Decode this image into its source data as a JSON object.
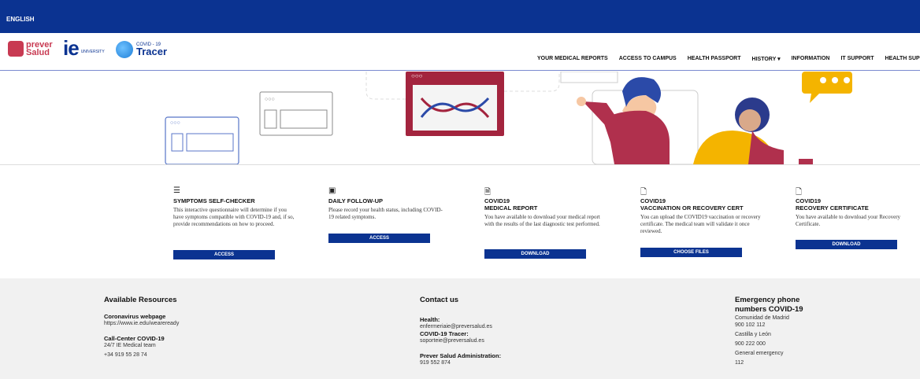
{
  "topbar": {
    "language": "ENGLISH"
  },
  "logos": {
    "prever": "prever Salud",
    "ie": "ie",
    "ie_sub": "UNIVERSITY",
    "tracer_small": "COVID - 19",
    "tracer_big": "Tracer"
  },
  "nav": {
    "items": [
      "YOUR MEDICAL REPORTS",
      "ACCESS TO CAMPUS",
      "HEALTH PASSPORT",
      "HISTORY ▾",
      "INFORMATION",
      "IT SUPPORT",
      "HEALTH SUPPO"
    ]
  },
  "cards": [
    {
      "icon": "list-icon",
      "title": "SYMPTOMS SELF-CHECKER",
      "desc": "This interactive questionnaire will determine if you have symptoms compatible with COVID-19 and, if so, provide recommendations on how to proceed.",
      "button": "ACCESS"
    },
    {
      "icon": "id-card-icon",
      "title": "DAILY FOLLOW-UP",
      "desc": "Please record your health status, including COVID-19 related symptoms.",
      "button": "ACCESS"
    },
    {
      "icon": "document-icon",
      "title": "COVID19\nMEDICAL REPORT",
      "title1": "COVID19",
      "title2": "MEDICAL REPORT",
      "desc": "You have available to download your medical report with the results of the last diagnostic test performed.",
      "button": "DOWNLOAD"
    },
    {
      "icon": "pdf-icon",
      "title1": "COVID19",
      "title2": "VACCINATION OR RECOVERY CERT",
      "desc": "You can upload the COVID19 vaccination or recovery certificate. The medical team will validate it once reviewed.",
      "button": "CHOOSE FILES"
    },
    {
      "icon": "pdf-icon",
      "title1": "COVID19",
      "title2": "RECOVERY CERTIFICATE",
      "desc": "You have available to download your Recovery Certificate.",
      "button": "DOWNLOAD"
    }
  ],
  "footer": {
    "resources": {
      "heading": "Available Resources",
      "webpage_label": "Coronavirus webpage",
      "webpage_url": "https://www.ie.edu/weareready",
      "callcenter_label": "Call-Center COVID-19",
      "callcenter_team": "24/7 IE Medical team",
      "callcenter_phone": "+34 919 55 28 74"
    },
    "contact": {
      "heading": "Contact us",
      "health_label": "Health:",
      "health_email": "enfermeriaie@preversalud.es",
      "tracer_label": "COVID-19 Tracer:",
      "tracer_email": "soporteie@preversalud.es",
      "admin_label": "Prever Salud Administration:",
      "admin_phone": "919 552 874"
    },
    "emergency": {
      "heading": "Emergency phone numbers COVID-19",
      "madrid_label": "Comunidad de Madrid",
      "madrid_phone": "900 102 112",
      "cyl_label": "Castilla y León",
      "cyl_phone": "900 222 000",
      "general_label": "General emergency",
      "general_phone": "112"
    }
  }
}
